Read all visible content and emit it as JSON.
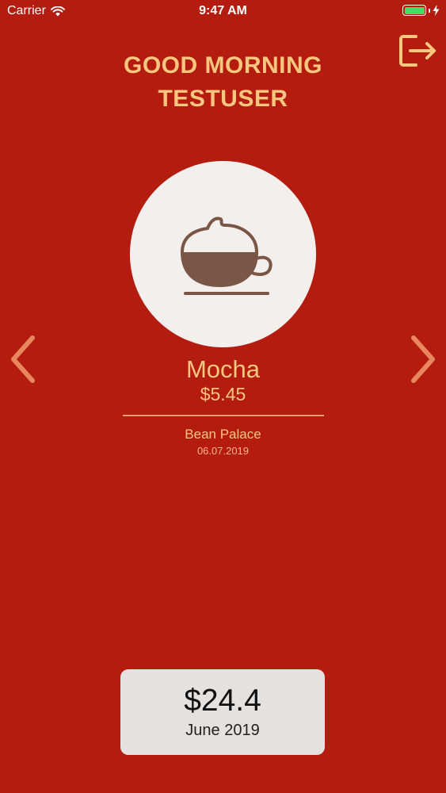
{
  "status_bar": {
    "carrier": "Carrier",
    "time": "9:47 AM",
    "battery_color": "#4cd964",
    "icons": [
      "wifi-icon",
      "battery-icon",
      "charging-bolt-icon"
    ]
  },
  "header": {
    "greeting_line1": "GOOD MORNING",
    "greeting_line2": "TESTUSER",
    "logout_icon": "logout-icon"
  },
  "drink": {
    "icon": "coffee-cup-icon",
    "name": "Mocha",
    "price": "$5.45",
    "shop": "Bean Palace",
    "date": "06.07.2019"
  },
  "navigation": {
    "previous_icon": "chevron-left-icon",
    "next_icon": "chevron-right-icon"
  },
  "summary": {
    "total": "$24.4",
    "period": "June 2019"
  },
  "colors": {
    "background": "#b51c10",
    "accent": "#f8c77f",
    "cup": "#7a5646",
    "circle": "#f3efec",
    "card": "#e4e1df"
  }
}
